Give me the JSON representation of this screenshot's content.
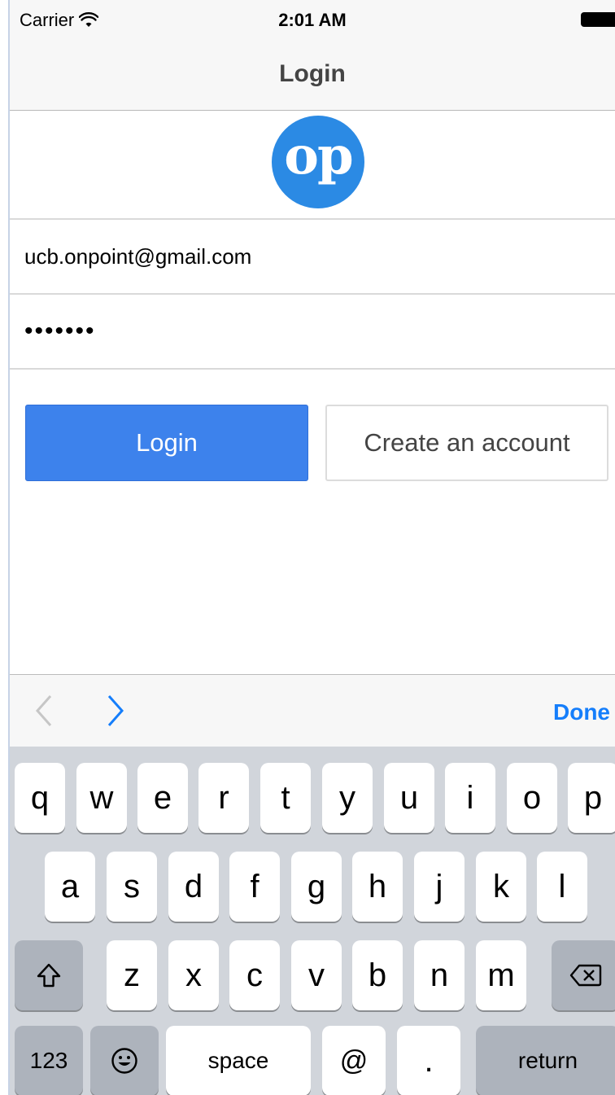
{
  "status_bar": {
    "carrier": "Carrier",
    "time": "2:01 AM"
  },
  "nav": {
    "title": "Login"
  },
  "logo": {
    "text": "op",
    "color": "#2b8ae4"
  },
  "form": {
    "email_value": "ucb.onpoint@gmail.com",
    "password_mask": "•••••••"
  },
  "buttons": {
    "login": "Login",
    "create": "Create an account"
  },
  "colors": {
    "accent": "#3d82ec",
    "done": "#157efb",
    "keyboard_bg": "#d1d5db"
  },
  "keyboard_toolbar": {
    "done": "Done"
  },
  "keyboard": {
    "row1": [
      "q",
      "w",
      "e",
      "r",
      "t",
      "y",
      "u",
      "i",
      "o",
      "p"
    ],
    "row2": [
      "a",
      "s",
      "d",
      "f",
      "g",
      "h",
      "j",
      "k",
      "l"
    ],
    "row3": [
      "z",
      "x",
      "c",
      "v",
      "b",
      "n",
      "m"
    ],
    "numbers_key": "123",
    "space_key": "space",
    "at_key": "@",
    "dot_key": ".",
    "return_key": "return"
  }
}
